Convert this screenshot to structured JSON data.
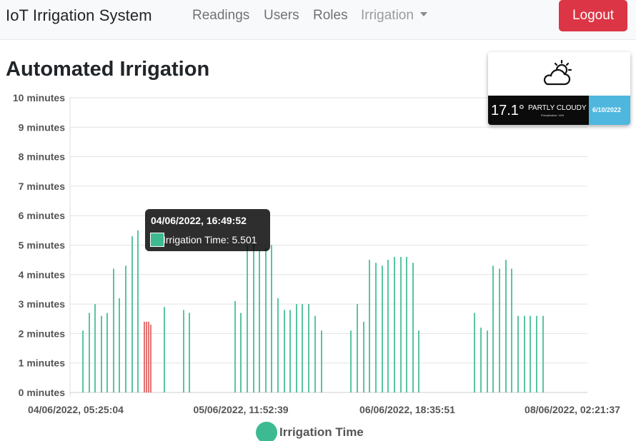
{
  "navbar": {
    "brand": "IoT Irrigation System",
    "links": [
      "Readings",
      "Users",
      "Roles"
    ],
    "dropdown_label": "Irrigation",
    "logout_label": "Logout",
    "logout_color": "#dc3545"
  },
  "page": {
    "title": "Automated Irrigation"
  },
  "weather": {
    "icon": "partly-cloudy-icon",
    "temperature": "17.1°",
    "condition": "PARTLY CLOUDY",
    "precipitation": "Precipitation: 14%",
    "date": "6/10/2022"
  },
  "tooltip": {
    "title": "04/06/2022, 16:49:52",
    "body": "Irrigation Time: 5.501"
  },
  "chart_data": {
    "type": "bar",
    "ylabel": "",
    "xlabel": "",
    "ylim": [
      0,
      10
    ],
    "y_ticks": [
      "0 minutes",
      "1 minutes",
      "2 minutes",
      "3 minutes",
      "4 minutes",
      "5 minutes",
      "6 minutes",
      "7 minutes",
      "8 minutes",
      "9 minutes",
      "10 minutes"
    ],
    "x_ticks": [
      "04/06/2022, 05:25:04",
      "05/06/2022, 11:52:39",
      "06/06/2022, 18:35:51",
      "08/06/2022, 02:21:37"
    ],
    "grid": true,
    "legend_position": "bottom",
    "series": [
      {
        "name": "Irrigation Time",
        "color": "#3dba92",
        "highlight_color": "#e05a5a",
        "values": [
          2.1,
          2.7,
          3.0,
          2.6,
          2.7,
          4.2,
          3.2,
          4.3,
          5.3,
          5.501,
          2.4,
          2.4,
          2.4,
          2.3,
          2.9,
          2.8,
          2.7,
          3.1,
          2.7,
          5.0,
          5.1,
          4.8,
          4.9,
          5.0,
          3.2,
          2.8,
          2.8,
          3.0,
          3.0,
          3.0,
          2.6,
          2.1,
          2.1,
          3.0,
          2.4,
          4.5,
          4.4,
          4.3,
          4.5,
          4.6,
          4.6,
          4.6,
          4.4,
          2.1,
          2.7,
          2.2,
          2.1,
          4.3,
          4.2,
          4.5,
          4.2,
          2.6,
          2.6,
          2.6,
          2.6,
          2.6
        ],
        "highlighted_indices": [
          10,
          11,
          12,
          13
        ]
      }
    ]
  }
}
